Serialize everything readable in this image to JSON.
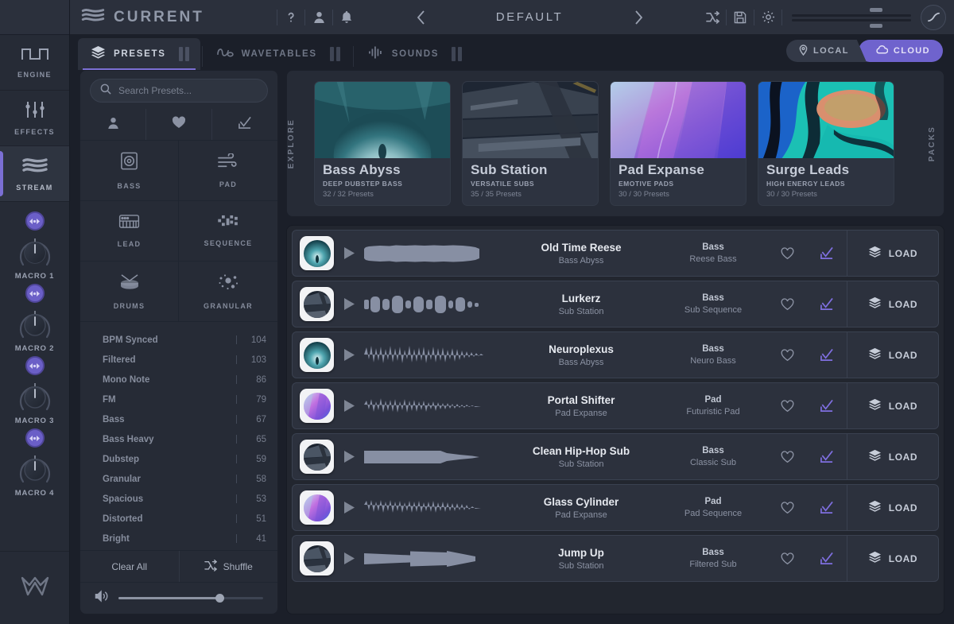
{
  "app": {
    "brand": "CURRENT",
    "brand_icon": "stream-logo-icon",
    "help_icon": "question-mark-icon",
    "account_icon": "user-icon",
    "notifications_icon": "bell-icon",
    "prev_icon": "chevron-left-icon",
    "next_icon": "chevron-right-icon",
    "preset_name": "DEFAULT",
    "shuffle_icon": "shuffle-icon",
    "save_icon": "save-disk-icon",
    "settings_icon": "gear-icon",
    "curve_icon": "s-curve-icon",
    "accent": "#7b6fd4",
    "bg": "#1b1f29"
  },
  "rail": {
    "items": [
      {
        "label": "ENGINE",
        "icon": "square-wave-icon",
        "active": false
      },
      {
        "label": "EFFECTS",
        "icon": "sliders-icon",
        "active": false
      },
      {
        "label": "STREAM",
        "icon": "stream-waves-icon",
        "active": true
      }
    ],
    "macros": [
      {
        "label": "MACRO 1",
        "learn_icon": "midi-learn-icon",
        "value": 50
      },
      {
        "label": "MACRO 2",
        "learn_icon": "midi-learn-icon",
        "value": 50
      },
      {
        "label": "MACRO 3",
        "learn_icon": "midi-learn-icon",
        "value": 50
      },
      {
        "label": "MACRO 4",
        "learn_icon": "midi-learn-icon",
        "value": 50
      }
    ],
    "footer_logo": "minimal-m-logo-icon"
  },
  "tabs": [
    {
      "label": "PRESETS",
      "icon": "layers-icon",
      "active": true
    },
    {
      "label": "WAVETABLES",
      "icon": "wavetable-icon",
      "active": false
    },
    {
      "label": "SOUNDS",
      "icon": "audio-bars-icon",
      "active": false
    }
  ],
  "source_toggle": {
    "local": {
      "label": "LOCAL",
      "icon": "location-pin-icon",
      "active": false
    },
    "cloud": {
      "label": "CLOUD",
      "icon": "cloud-icon",
      "active": true
    }
  },
  "search": {
    "placeholder": "Search Presets...",
    "value": "",
    "icon": "search-icon"
  },
  "quick_filters": [
    {
      "name": "user-filter",
      "icon": "user-icon"
    },
    {
      "name": "favorites-filter",
      "icon": "heart-icon"
    },
    {
      "name": "selected-filter",
      "icon": "checkmark-down-icon"
    }
  ],
  "categories": [
    {
      "label": "BASS",
      "icon": "speaker-cabinet-icon"
    },
    {
      "label": "PAD",
      "icon": "wind-icon"
    },
    {
      "label": "LEAD",
      "icon": "keyboard-icon"
    },
    {
      "label": "SEQUENCE",
      "icon": "sequencer-grid-icon"
    },
    {
      "label": "DRUMS",
      "icon": "snare-drum-icon"
    },
    {
      "label": "GRANULAR",
      "icon": "particles-icon"
    }
  ],
  "tags": [
    {
      "name": "BPM Synced",
      "count": "104"
    },
    {
      "name": "Filtered",
      "count": "103"
    },
    {
      "name": "Mono Note",
      "count": "86"
    },
    {
      "name": "FM",
      "count": "79"
    },
    {
      "name": "Bass",
      "count": "67"
    },
    {
      "name": "Bass Heavy",
      "count": "65"
    },
    {
      "name": "Dubstep",
      "count": "59"
    },
    {
      "name": "Granular",
      "count": "58"
    },
    {
      "name": "Spacious",
      "count": "53"
    },
    {
      "name": "Distorted",
      "count": "51"
    },
    {
      "name": "Bright",
      "count": "41"
    }
  ],
  "browser_actions": {
    "clear_all": "Clear All",
    "shuffle": "Shuffle",
    "shuffle_icon": "shuffle-icon",
    "volume_icon": "speaker-icon",
    "volume": 70
  },
  "explore": {
    "label": "EXPLORE",
    "packs_label": "PACKS",
    "cards": [
      {
        "title": "Bass Abyss",
        "subtitle": "DEEP DUBSTEP BASS",
        "count": "32 / 32 Presets",
        "art": "teal-cave"
      },
      {
        "title": "Sub Station",
        "subtitle": "VERSATILE SUBS",
        "count": "35 / 35 Presets",
        "art": "dark-machinery"
      },
      {
        "title": "Pad Expanse",
        "subtitle": "EMOTIVE PADS",
        "count": "30 / 30 Presets",
        "art": "purple-gradient"
      },
      {
        "title": "Surge Leads",
        "subtitle": "HIGH ENERGY LEADS",
        "count": "30 / 30 Presets",
        "art": "teal-swirl"
      }
    ]
  },
  "preset_list": {
    "load_label": "LOAD",
    "load_icon": "layers-icon",
    "play_icon": "play-icon",
    "favorite_icon": "heart-icon",
    "select_icon": "checkmark-down-icon",
    "rows": [
      {
        "name": "Old Time Reese",
        "pack": "Bass Abyss",
        "category": "Bass",
        "subcategory": "Reese Bass",
        "art": "teal-cave",
        "wave": "solid-dense",
        "selected": true
      },
      {
        "name": "Lurkerz",
        "pack": "Sub Station",
        "category": "Bass",
        "subcategory": "Sub Sequence",
        "art": "dark-machinery",
        "wave": "pulses",
        "selected": true
      },
      {
        "name": "Neuroplexus",
        "pack": "Bass Abyss",
        "category": "Bass",
        "subcategory": "Neuro Bass",
        "art": "teal-cave",
        "wave": "jagged",
        "selected": true
      },
      {
        "name": "Portal Shifter",
        "pack": "Pad Expanse",
        "category": "Pad",
        "subcategory": "Futuristic Pad",
        "art": "purple-gradient",
        "wave": "noisy-decay",
        "selected": true
      },
      {
        "name": "Clean Hip-Hop Sub",
        "pack": "Sub Station",
        "category": "Bass",
        "subcategory": "Classic Sub",
        "art": "dark-machinery",
        "wave": "smooth-sub",
        "selected": true
      },
      {
        "name": "Glass Cylinder",
        "pack": "Pad Expanse",
        "category": "Pad",
        "subcategory": "Pad Sequence",
        "art": "purple-gradient",
        "wave": "noisy-even",
        "selected": true
      },
      {
        "name": "Jump Up",
        "pack": "Sub Station",
        "category": "Bass",
        "subcategory": "Filtered Sub",
        "art": "dark-machinery",
        "wave": "taper-burst",
        "selected": true
      }
    ]
  }
}
